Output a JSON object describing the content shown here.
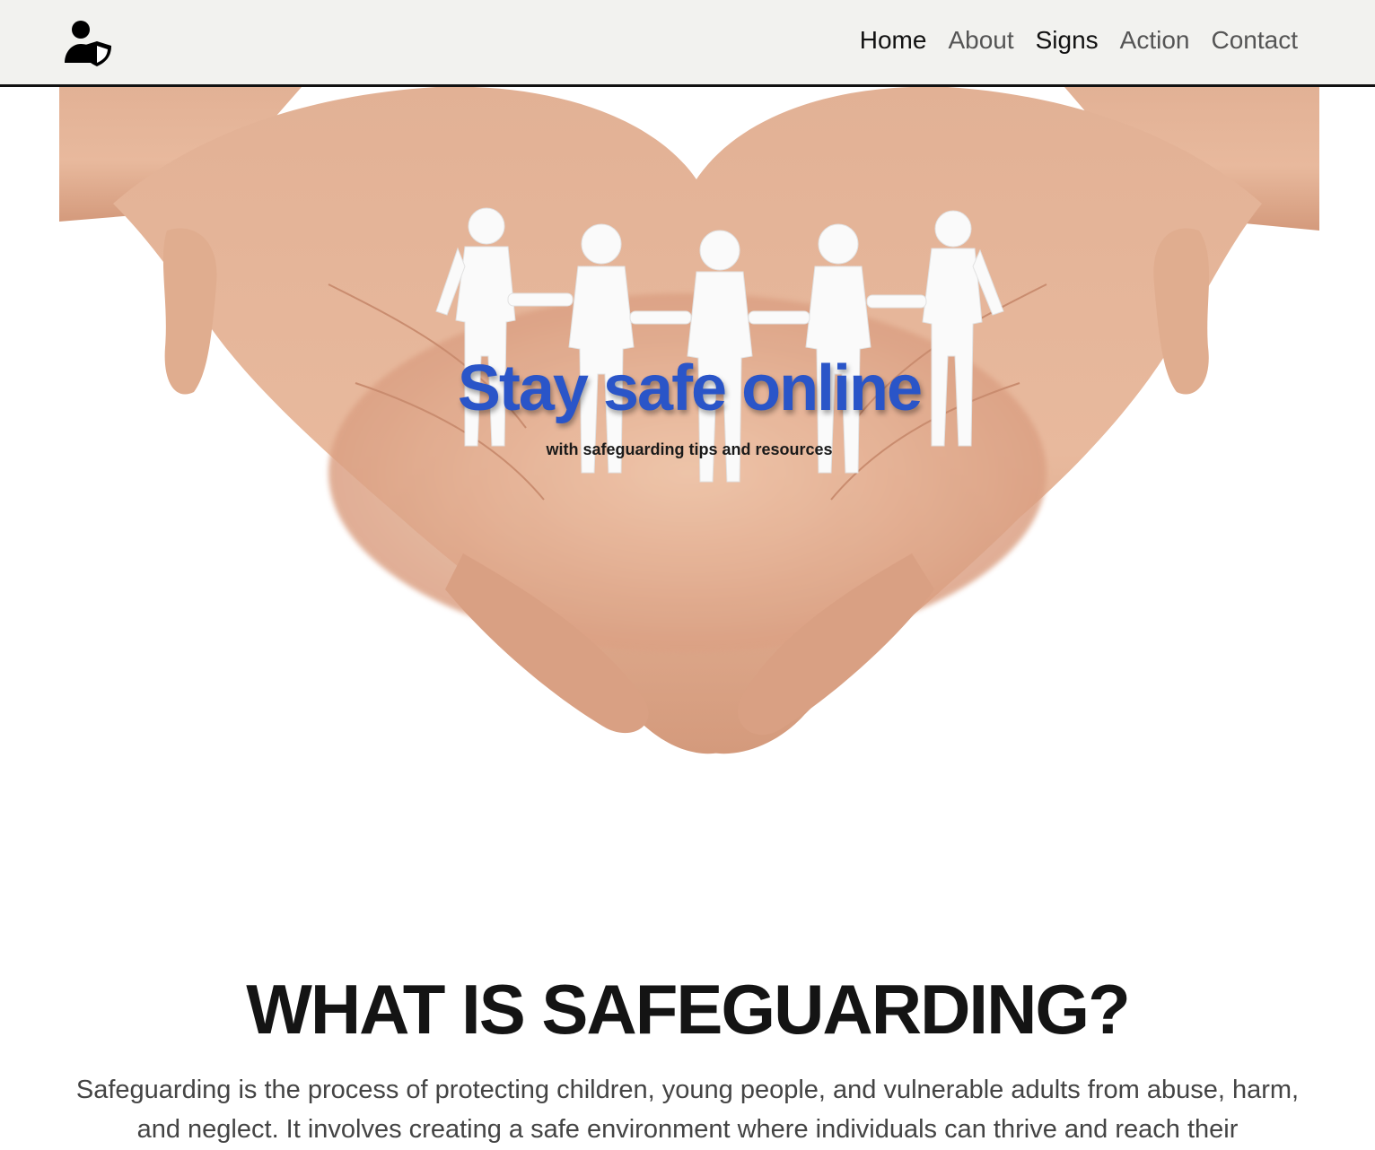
{
  "header": {
    "logo_icon": "user-shield-icon",
    "nav": [
      {
        "label": "Home"
      },
      {
        "label": "About"
      },
      {
        "label": "Signs"
      },
      {
        "label": "Action"
      },
      {
        "label": "Contact"
      }
    ]
  },
  "hero": {
    "image": "hands-holding-paper-people",
    "title": "Stay safe online",
    "subtitle": "with safeguarding tips and resources"
  },
  "section": {
    "title": "WHAT IS SAFEGUARDING?",
    "body": "Safeguarding is the process of protecting children, young people, and vulnerable adults from abuse, harm, and neglect. It involves creating a safe environment where individuals can thrive and reach their"
  },
  "colors": {
    "navbar_bg": "#f2f2ef",
    "hero_title": "#2a55c8",
    "heading": "#141414",
    "body_text": "#444444"
  }
}
